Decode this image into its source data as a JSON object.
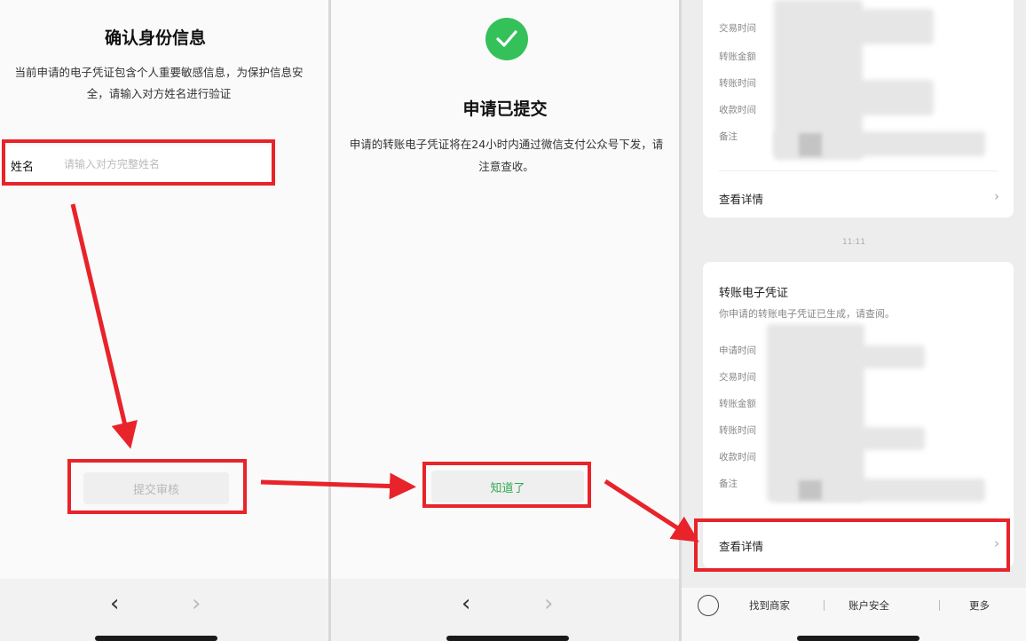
{
  "panel1": {
    "title": "确认身份信息",
    "description": "当前申请的电子凭证包含个人重要敏感信息，为保护信息安全，请输入对方姓名进行验证",
    "name_label": "姓名",
    "name_placeholder": "请输入对方完整姓名",
    "submit_label": "提交审核"
  },
  "panel2": {
    "title": "申请已提交",
    "description": "申请的转账电子凭证将在24小时内通过微信支付公众号下发，请注意查收。",
    "ok_label": "知道了"
  },
  "panel3": {
    "card_a": {
      "row_labels": [
        "交易时间",
        "转账金额",
        "转账时间",
        "收款时间",
        "备注"
      ],
      "view_details": "查看详情"
    },
    "time_label": "11:11",
    "card_b": {
      "title": "转账电子凭证",
      "subtitle": "你申请的转账电子凭证已生成，请查阅。",
      "row_labels": [
        "申请时间",
        "交易时间",
        "转账金额",
        "转账时间",
        "收款时间",
        "备注"
      ],
      "view_details": "查看详情"
    },
    "bottom_tabs": [
      "找到商家",
      "账户安全",
      "更多"
    ]
  },
  "nav": {
    "back_glyph": "‹",
    "forward_glyph": "›"
  },
  "colors": {
    "accent_green": "#35c15a",
    "annotation_red": "#e8232a"
  }
}
